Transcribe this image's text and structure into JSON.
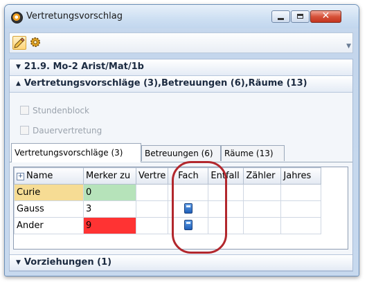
{
  "window": {
    "title": "Vertretungsvorschlag",
    "close_glyph": "✕"
  },
  "sections": {
    "lesson": {
      "arrow": "▼",
      "label": "21.9. Mo-2 Arist/Mat/1b"
    },
    "suggestions": {
      "arrow": "▲",
      "label": "Vertretungsvorschläge (3),Betreuungen (6),Räume (13)"
    },
    "moves": {
      "arrow": "▼",
      "label": "Vorziehungen (1)"
    }
  },
  "options": {
    "block": "Stundenblock",
    "permanent": "Dauervertretung"
  },
  "tabs": [
    "Vertretungsvorschläge (3)",
    "Betreuungen (6)",
    "Räume (13)"
  ],
  "table": {
    "columns": [
      "Name",
      "Merker zu",
      "Vertre",
      "Fach",
      "Entfall",
      "Zähler",
      "Jahres"
    ],
    "rows": [
      {
        "name": "Curie",
        "marker": "0",
        "subject_icon": false,
        "marker_color": "#b6e3ba",
        "name_color": "#f6dc94"
      },
      {
        "name": "Gauss",
        "marker": "3",
        "subject_icon": true,
        "marker_color": "#ffffff",
        "name_color": "#ffffff"
      },
      {
        "name": "Ander",
        "marker": "9",
        "subject_icon": true,
        "marker_color": "#ff3333",
        "name_color": "#ffffff"
      }
    ]
  },
  "icons": {
    "app": "clock-app-icon",
    "tool1": "pencil-edit-icon",
    "tool2": "gear-icon",
    "subject": "book-icon"
  }
}
